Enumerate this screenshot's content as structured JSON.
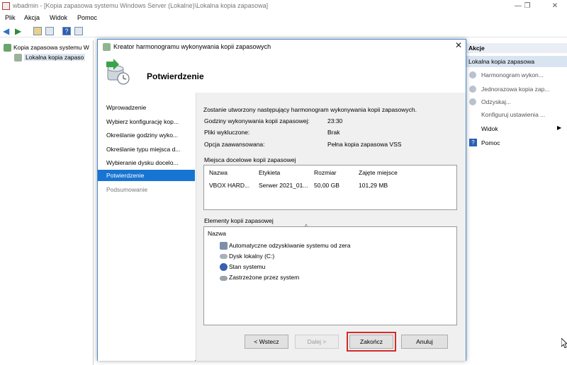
{
  "window": {
    "title": "wbadmin - [Kopia zapasowa systemu Windows Server (Lokalne)\\Lokalna kopia zapasowa]",
    "minimize": "—",
    "maximize": "❐",
    "close": "✕"
  },
  "menu": [
    "Plik",
    "Akcja",
    "Widok",
    "Pomoc"
  ],
  "tree": {
    "root": "Kopia zapasowa systemu W",
    "child": "Lokalna kopia zapaso"
  },
  "actions": {
    "header": "Akcje",
    "selected": "Lokalna kopia zapasowa",
    "items": [
      "Harmonogram wykon...",
      "Jednorazowa kopia zap...",
      "Odzyskaj...",
      "Konfiguruj ustawienia ...",
      "Widok",
      "Pomoc"
    ]
  },
  "dialog": {
    "title": "Kreator harmonogramu wykonywania kopii zapasowych",
    "page_title": "Potwierdzenie",
    "steps": [
      "Wprowadzenie",
      "Wybierz konfigurację kop...",
      "Określanie godziny wyko...",
      "Określanie typu miejsca d...",
      "Wybieranie dysku docelo...",
      "Potwierdzenie",
      "Podsumowanie"
    ],
    "intro": "Zostanie utworzony następujący harmonogram wykonywania kopii zapasowych.",
    "summary": [
      {
        "label": "Godziny wykonywania kopii zapasowej:",
        "value": "23:30"
      },
      {
        "label": "Pliki wykluczone:",
        "value": "Brak"
      },
      {
        "label": "Opcja zaawansowana:",
        "value": "Pełna kopia zapasowa VSS"
      }
    ],
    "destinations": {
      "label": "Miejsca docelowe kopii zapasowej",
      "columns": [
        "Nazwa",
        "Etykieta",
        "Rozmiar",
        "Zajęte miejsce"
      ],
      "rows": [
        [
          "VBOX HARD...",
          "Serwer 2021_01...",
          "50,00 GB",
          "101,29 MB"
        ]
      ]
    },
    "items": {
      "label": "Elementy kopii zapasowej",
      "column": "Nazwa",
      "sort_glyph": "^",
      "rows": [
        "Automatyczne odzyskiwanie systemu od zera",
        "Dysk lokalny (C:)",
        "Stan systemu",
        "Zastrzeżone przez system"
      ]
    },
    "buttons": {
      "back": "< Wstecz",
      "next": "Dalej >",
      "finish": "Zakończ",
      "cancel": "Anuluj"
    },
    "close_glyph": "✕"
  },
  "colors": {
    "accent": "#1874d3",
    "focus_outline": "#d32a2a"
  }
}
